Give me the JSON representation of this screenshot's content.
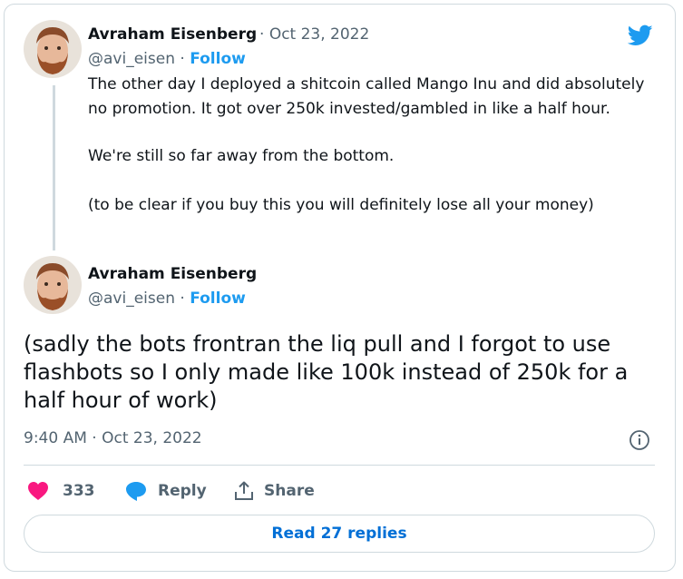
{
  "tweet1": {
    "author_name": "Avraham Eisenberg",
    "separator": "·",
    "date": "Oct 23, 2022",
    "handle": "@avi_eisen",
    "follow_label": "Follow",
    "paragraphs": [
      "The other day I deployed a shitcoin called Mango Inu and did absolutely no promotion. It got over 250k invested/gambled in like a half hour.",
      "We're still so far away from the bottom.",
      "(to be clear if you buy this you will definitely lose all your money)"
    ]
  },
  "tweet2": {
    "author_name": "Avraham Eisenberg",
    "handle": "@avi_eisen",
    "separator": "·",
    "follow_label": "Follow",
    "text": "(sadly the bots frontran the liq pull and I forgot to use flashbots so I only made like 100k instead of 250k for a half hour of work)",
    "timestamp": "9:40 AM · Oct 23, 2022"
  },
  "actions": {
    "like_count": "333",
    "reply_label": "Reply",
    "share_label": "Share"
  },
  "read_replies_label": "Read 27 replies",
  "colors": {
    "accent": "#1d9bf0",
    "heart": "#f91880",
    "link_dark": "#006fd6",
    "secondary_text": "#536471",
    "border": "#cfd9de"
  },
  "icons": {
    "brand": "twitter-bird-icon",
    "like": "heart-icon",
    "reply": "speech-bubble-icon",
    "share": "share-upload-icon",
    "info": "info-circle-icon"
  }
}
